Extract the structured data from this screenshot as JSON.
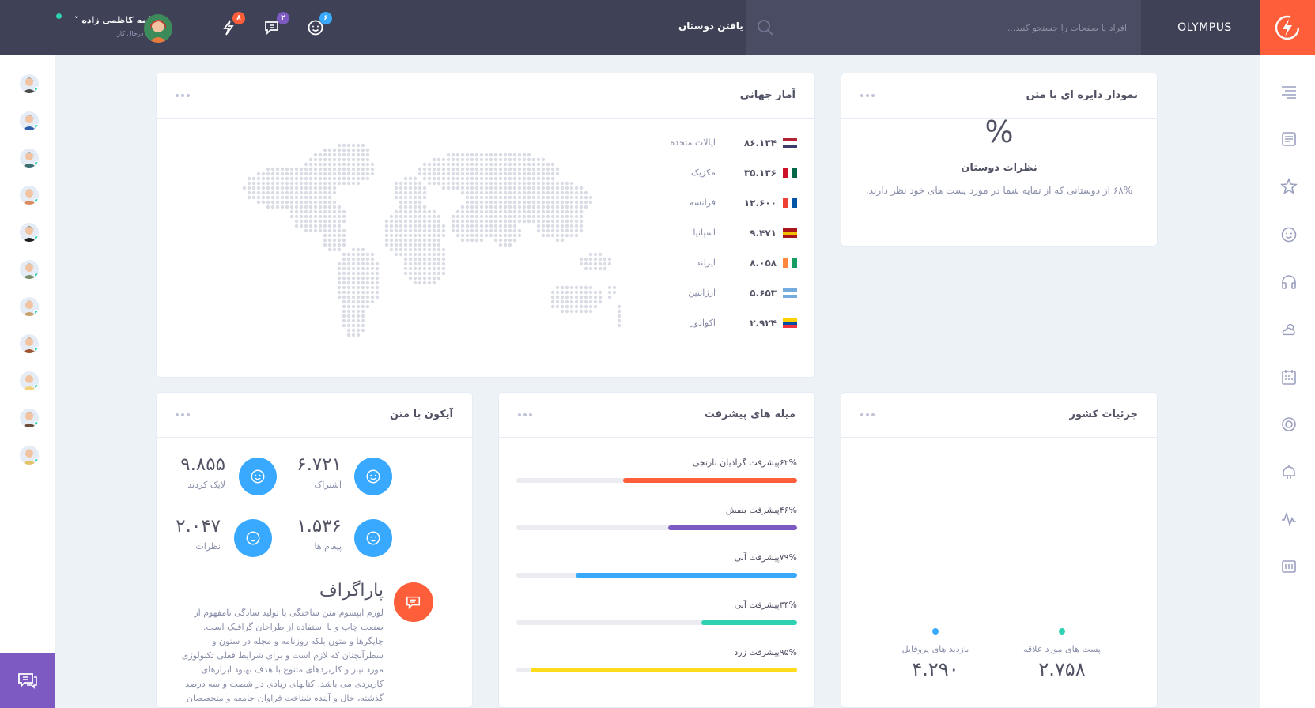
{
  "header": {
    "brand": "OLYMPUS",
    "search_placeholder": "افراد یا صفحات را جستجو کنید...",
    "find_friends": "یافتن دوستان",
    "badges": {
      "friends": "۶",
      "messages": "۲",
      "activity": "۸"
    },
    "profile_name": "فاطمه کاظمی زاده",
    "profile_status": "درحال کار"
  },
  "colors": {
    "topbar": "#3f4257",
    "accent_orange": "#ff5e3a",
    "purple": "#7c5ac2",
    "blue": "#38a9ff",
    "green": "#2ed1b2",
    "yellow": "#ffdc1b"
  },
  "pie_card": {
    "title": "نمودار دایره ای با متن",
    "symbol": "%",
    "subtitle": "نظرات دوستان",
    "text": "۶۸% از دوستانی که از نمایه شما در مورد پست های خود نظر دارند."
  },
  "world_card": {
    "title": "آمار جهانی",
    "rows": [
      {
        "country": "ایالات متحده",
        "value": "۸۶.۱۳۴",
        "flag": "us"
      },
      {
        "country": "مکزیک",
        "value": "۳۵.۱۳۶",
        "flag": "mx"
      },
      {
        "country": "فرانسه",
        "value": "۱۲.۶۰۰",
        "flag": "fr"
      },
      {
        "country": "اسپانیا",
        "value": "۹.۴۷۱",
        "flag": "es"
      },
      {
        "country": "ایرلند",
        "value": "۸.۰۵۸",
        "flag": "ie"
      },
      {
        "country": "ارژانتین",
        "value": "۵.۶۵۳",
        "flag": "ar"
      },
      {
        "country": "اکوادور",
        "value": "۲.۹۲۴",
        "flag": "ec"
      }
    ]
  },
  "country_card": {
    "title": "جزئیات کشور",
    "stats": [
      {
        "label": "پست های مورد علاقه",
        "value": "۲.۷۵۸",
        "color": "#2ed1b2"
      },
      {
        "label": "بازدید های پروفایل",
        "value": "۴.۲۹۰",
        "color": "#38a9ff"
      }
    ]
  },
  "progress_card": {
    "title": "میله های پیشرفت",
    "bars": [
      {
        "label": "۶۲%پیشرفت گرادیان نارنجی",
        "percent": 62,
        "color": "#ff5e3a"
      },
      {
        "label": "۴۶%پیشرفت بنفش",
        "percent": 46,
        "color": "#7c5ac2"
      },
      {
        "label": "۷۹%پیشرفت آبی",
        "percent": 79,
        "color": "#38a9ff"
      },
      {
        "label": "۳۴%پیشرفت آبی",
        "percent": 34,
        "color": "#2ed1b2"
      },
      {
        "label": "۹۵%پیشرفت زرد",
        "percent": 95,
        "color": "#ffdc1b"
      }
    ]
  },
  "icon_text_card": {
    "title": "آیکون با متن",
    "stats": [
      {
        "value": "۶.۷۲۱",
        "label": "اشتراک"
      },
      {
        "value": "۹.۸۵۵",
        "label": "لایک کردند"
      },
      {
        "value": "۱.۵۳۶",
        "label": "پیغام ها"
      },
      {
        "value": "۲.۰۴۷",
        "label": "نظرات"
      }
    ],
    "paragraph_title": "پاراگراف",
    "paragraph_text": "لورم ایپسوم متن ساختگی با تولید سادگی نامفهوم از صنعت چاپ و با استفاده از طراحان گرافیک است. چاپگرها و متون بلکه روزنامه و مجله در ستون و سطرآنچنان که لازم است و برای شرایط فعلی تکنولوژی مورد نیاز و کاربردهای متنوع با هدف بهبود ابزارهای کاربردی می باشد. کتابهای زیادی در شصت و سه درصد گذشته، حال و آینده شناخت فراوان جامعه و متخصصان"
  },
  "left_sidebar": {
    "friends": [
      "friend-1",
      "friend-2",
      "friend-3",
      "friend-4",
      "friend-5",
      "friend-6",
      "friend-7",
      "friend-8",
      "friend-9",
      "friend-10",
      "friend-11"
    ]
  },
  "right_sidebar": {
    "icons": [
      "menu-icon",
      "newsfeed-icon",
      "star-icon",
      "smile-icon",
      "headphones-icon",
      "weather-icon",
      "calendar-icon",
      "badge-icon",
      "music-icon",
      "stats-icon",
      "manage-widgets-icon"
    ]
  }
}
